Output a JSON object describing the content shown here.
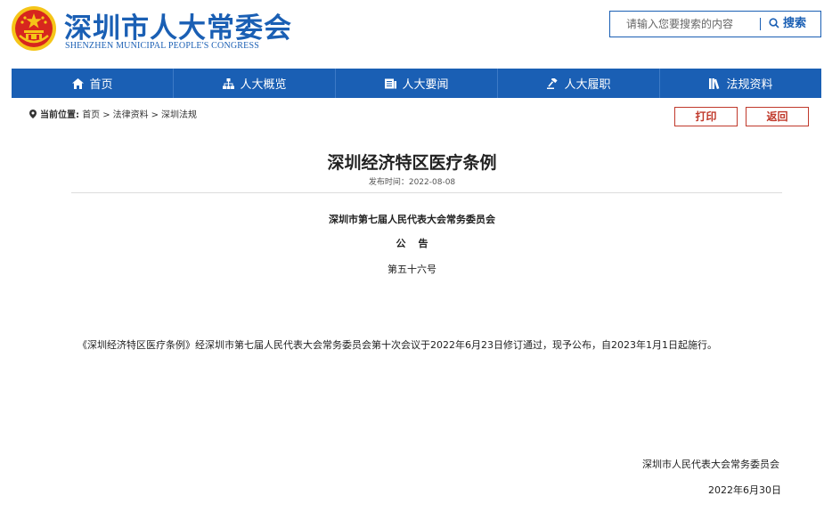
{
  "header": {
    "title": "深圳市人大常委会",
    "subtitle": "SHENZHEN MUNICIPAL PEOPLE'S CONGRESS",
    "emblem_icon": "national-emblem-icon"
  },
  "search": {
    "placeholder": "请输入您要搜索的内容",
    "button_label": "搜索",
    "icon": "search-icon"
  },
  "nav": {
    "items": [
      {
        "label": "首页",
        "icon": "home-icon"
      },
      {
        "label": "人大概览",
        "icon": "sitemap-icon"
      },
      {
        "label": "人大要闻",
        "icon": "news-icon"
      },
      {
        "label": "人大履职",
        "icon": "gavel-icon"
      },
      {
        "label": "法规资料",
        "icon": "books-icon"
      }
    ]
  },
  "breadcrumb": {
    "label": "当前位置:",
    "items": [
      "首页",
      "法律资料",
      "深圳法规"
    ],
    "separator": ">"
  },
  "actions": {
    "print_label": "打印",
    "back_label": "返回"
  },
  "article": {
    "title": "深圳经济特区医疗条例",
    "publish_date": "发布时间：2022-08-08",
    "org": "深圳市第七届人民代表大会常务委员会",
    "notice_chars": [
      "公",
      "告"
    ],
    "number": "第五十六号",
    "body": "《深圳经济特区医疗条例》经深圳市第七届人民代表大会常务委员会第十次会议于2022年6月23日修订通过，现予公布，自2023年1月1日起施行。",
    "sign_org": "深圳市人民代表大会常务委员会",
    "sign_date": "2022年6月30日"
  },
  "colors": {
    "brand_blue": "#1a5fb4",
    "action_red": "#c0392b",
    "emblem_red": "#d7261e",
    "emblem_gold": "#f5c518"
  }
}
